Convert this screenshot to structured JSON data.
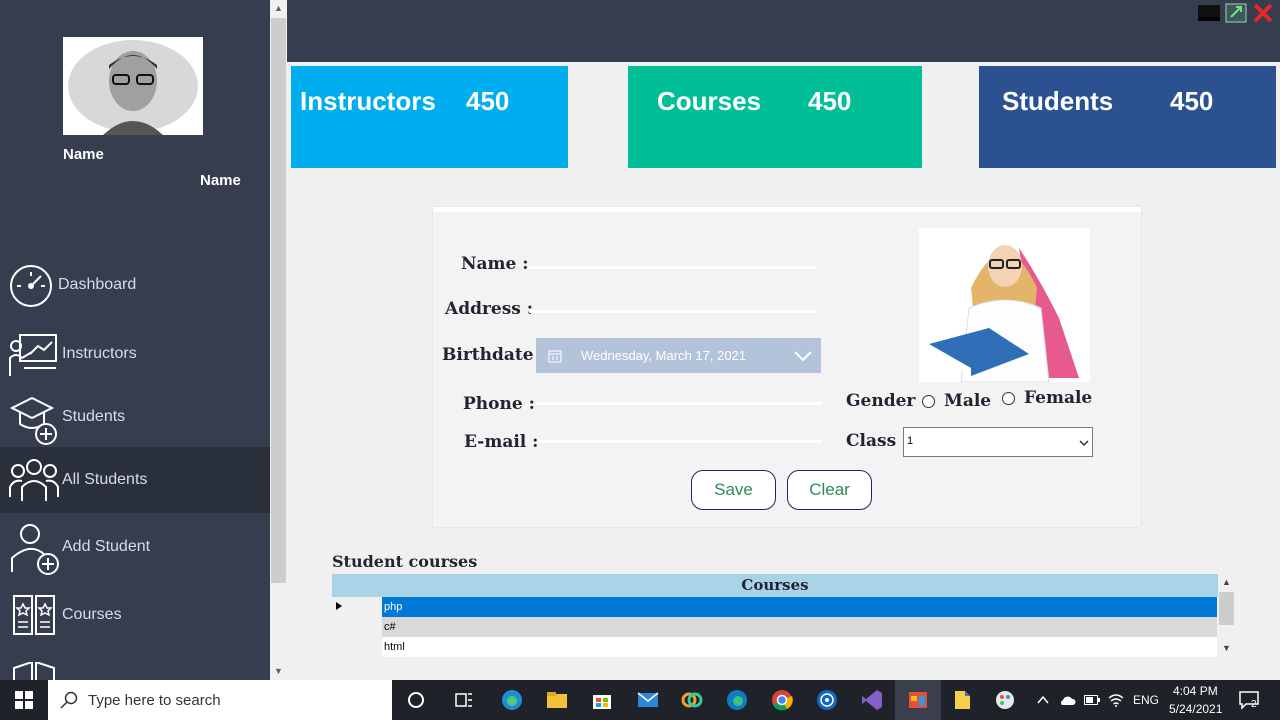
{
  "sidebar": {
    "profile_name_1": "Name",
    "profile_name_2": "Name",
    "items": [
      {
        "label": "Dashboard",
        "icon": "dashboard-icon"
      },
      {
        "label": "Instructors",
        "icon": "instructor-icon"
      },
      {
        "label": "Students",
        "icon": "student-cap-icon"
      },
      {
        "label": "All Students",
        "icon": "group-icon"
      },
      {
        "label": "Add Student",
        "icon": "add-user-icon"
      },
      {
        "label": "Courses",
        "icon": "courses-icon"
      }
    ]
  },
  "cards": {
    "instructors": {
      "label": "Instructors",
      "value": "450",
      "color": "#00aeef"
    },
    "courses": {
      "label": "Courses",
      "value": "450",
      "color": "#00be96"
    },
    "students": {
      "label": "Students",
      "value": "450",
      "color": "#2b5190"
    }
  },
  "form": {
    "name_label": "Name :",
    "address_label": "Address :",
    "birthdate_label": "Birthdate :",
    "birthdate_value": "Wednesday, March 17, 2021",
    "phone_label": "Phone :",
    "email_label": "E-mail :",
    "gender_label": "Gender",
    "gender_male": "Male",
    "gender_female": "Female",
    "class_label": "Class :",
    "class_value": "1",
    "save_label": "Save",
    "clear_label": "Clear"
  },
  "courses_grid": {
    "title": "Student courses",
    "header": "Courses",
    "rows": [
      "php",
      "c#",
      "html"
    ]
  },
  "taskbar": {
    "search_placeholder": "Type here to search",
    "language": "ENG",
    "time": "4:04 PM",
    "date": "5/24/2021",
    "notification_count": "2"
  }
}
